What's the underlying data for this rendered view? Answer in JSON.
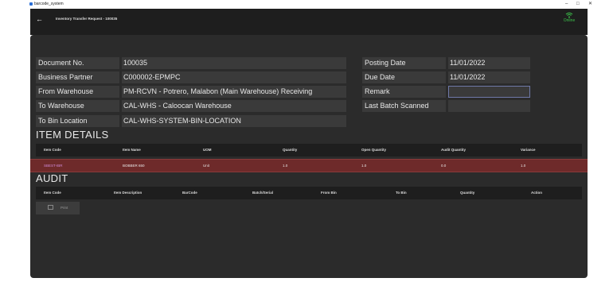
{
  "window": {
    "title": "barcode_system",
    "minimize": "–",
    "maximize": "□",
    "close": "✕"
  },
  "appbar": {
    "back_icon": "arrow-left-icon",
    "title": "Inventory Transfer Request - 100035",
    "status": "Online",
    "status_icon": "wifi-icon",
    "status_color": "#3cc24a"
  },
  "header": {
    "document_no_label": "Document No.",
    "document_no": "100035",
    "business_partner_label": "Business Partner",
    "business_partner": "C000002-EPMPC",
    "from_warehouse_label": "From Warehouse",
    "from_warehouse": "PM-RCVN - Potrero, Malabon (Main Warehouse) Receiving",
    "to_warehouse_label": "To Warehouse",
    "to_warehouse": "CAL-WHS - Caloocan Warehouse",
    "to_bin_label": "To Bin Location",
    "to_bin": "CAL-WHS-SYSTEM-BIN-LOCATION",
    "posting_date_label": "Posting Date",
    "posting_date": "11/01/2022",
    "due_date_label": "Due Date",
    "due_date": "11/01/2022",
    "remark_label": "Remark",
    "remark": "",
    "last_batch_label": "Last Batch Scanned",
    "last_batch": ""
  },
  "item_details": {
    "title": "ITEM DETAILS",
    "columns": [
      "Item Code",
      "Item Name",
      "UOM",
      "Quantity",
      "Open Quantity",
      "Audit Quantity",
      "Variance"
    ],
    "rows": [
      {
        "item_code": "SBEST-IBR",
        "item_name": "BOBBER 650",
        "uom": "Unit",
        "quantity": "1.0",
        "open_quantity": "1.0",
        "audit_quantity": "0.0",
        "variance": "1.0"
      }
    ],
    "row_color": "#6e2a2a"
  },
  "audit": {
    "title": "AUDIT",
    "columns": [
      "Item Code",
      "Item Description",
      "BarCode",
      "Batch/Serial",
      "From Bin",
      "To Bin",
      "Quantity",
      "Action"
    ],
    "print_label": "Print",
    "print_icon": "printer-icon"
  }
}
